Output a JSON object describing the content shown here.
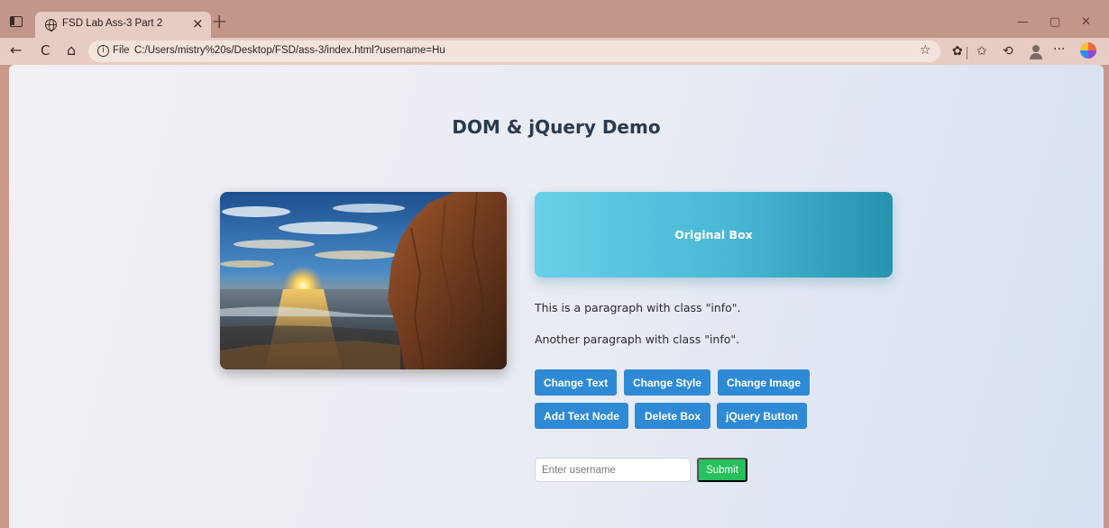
{
  "browser": {
    "tab_title": "FSD Lab Ass-3 Part 2",
    "tab_close": "×",
    "new_tab": "+",
    "file_label": "File",
    "url": "C:/Users/mistry%20s/Desktop/FSD/ass-3/index.html?username=Hu",
    "window_controls": {
      "minimize": "—",
      "maximize": "▢",
      "close": "✕"
    },
    "nav": {
      "back": "←",
      "refresh": "C",
      "home": "⌂"
    },
    "toolbar_icons": {
      "favorite": "☆",
      "extensions": "✿",
      "favorites": "✩",
      "history": "⟲",
      "more": "···"
    }
  },
  "page": {
    "title": "DOM & jQuery Demo",
    "box_label": "Original Box",
    "paragraphs": [
      "This is a paragraph with class \"info\".",
      "Another paragraph with class \"info\"."
    ],
    "buttons_row1": [
      "Change Text",
      "Change Style",
      "Change Image"
    ],
    "buttons_row2": [
      "Add Text Node",
      "Delete Box",
      "jQuery Button"
    ],
    "username_placeholder": "Enter username",
    "submit_label": "Submit"
  },
  "colors": {
    "titlebar": "#c3968a",
    "toolbar": "#e7ccc4",
    "button_blue": "#2f8ad6",
    "submit_green": "#26c05c",
    "box_start": "#68d0e8",
    "box_end": "#2593ad"
  }
}
